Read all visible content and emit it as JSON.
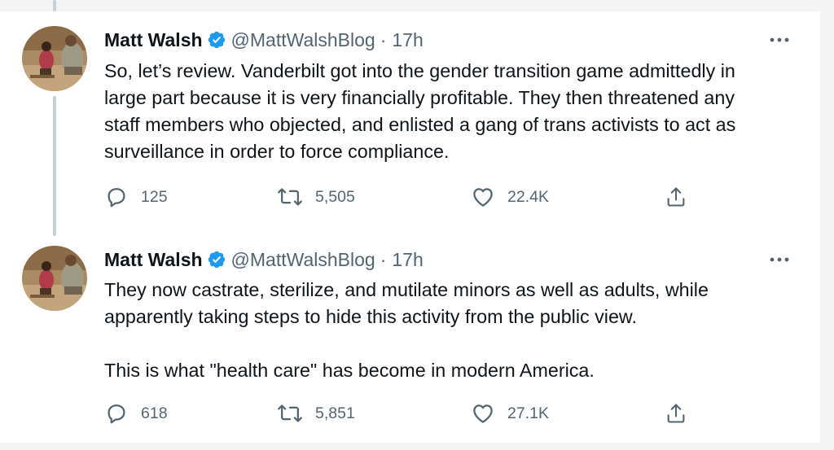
{
  "tweets": [
    {
      "author_name": "Matt Walsh",
      "handle": "@MattWalshBlog",
      "separator": "·",
      "time": "17h",
      "text": "So, let’s review. Vanderbilt got into the gender transition game admittedly in\nlarge part because it is very financially profitable. They then threatened any\nstaff members who objected, and enlisted a gang of trans activists to act as\nsurveillance in order to force compliance.",
      "replies": "125",
      "retweets": "5,505",
      "likes": "22.4K"
    },
    {
      "author_name": "Matt Walsh",
      "handle": "@MattWalshBlog",
      "separator": "·",
      "time": "17h",
      "text": "They now castrate, sterilize, and mutilate minors as well as adults, while\napparently taking steps to hide this activity from the public view.\n\nThis is what \"health care\" has become in modern America.",
      "replies": "618",
      "retweets": "5,851",
      "likes": "27.1K"
    }
  ],
  "icons": {
    "verified": "verified-badge-icon",
    "more": "more-options-icon",
    "reply": "reply-icon",
    "retweet": "retweet-icon",
    "like": "like-icon",
    "share": "share-icon"
  },
  "colors": {
    "verified_blue": "#1d9bf0",
    "secondary_text": "#536471",
    "primary_text": "#0f1419",
    "thread_line": "#c8d0d6"
  }
}
